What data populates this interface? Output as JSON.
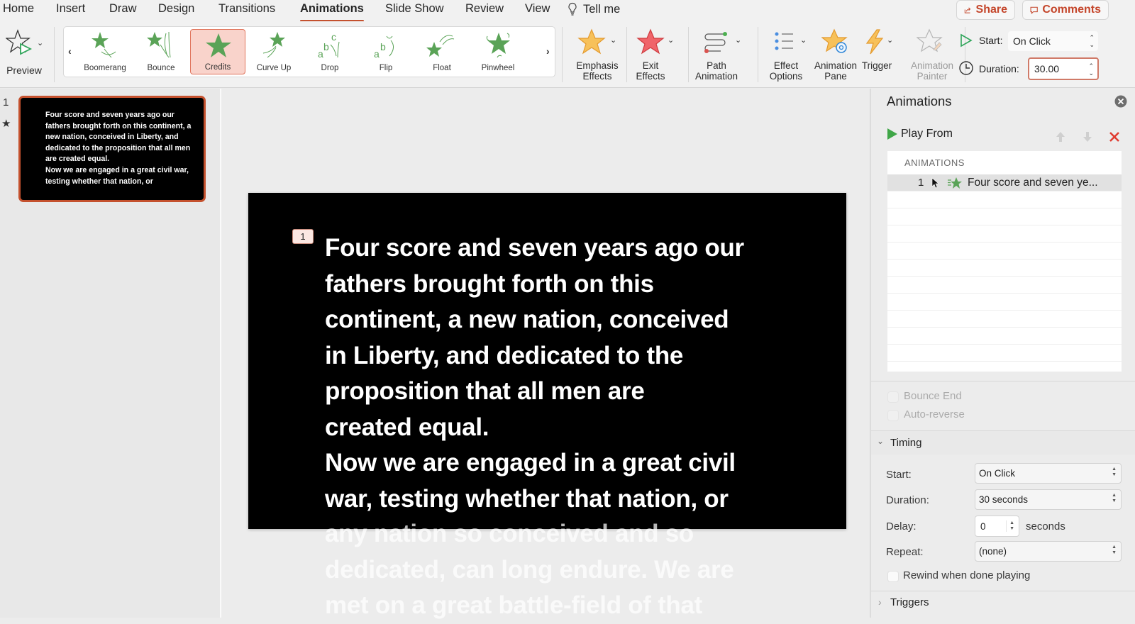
{
  "menu": {
    "tabs": [
      "Home",
      "Insert",
      "Draw",
      "Design",
      "Transitions",
      "Animations",
      "Slide Show",
      "Review",
      "View"
    ],
    "active_tab": "Animations",
    "tell_me": "Tell me",
    "share": "Share",
    "comments": "Comments"
  },
  "ribbon": {
    "preview": "Preview",
    "gallery": [
      {
        "label": "Boomerang",
        "icon": "boomerang-star-icon"
      },
      {
        "label": "Bounce",
        "icon": "bounce-star-icon"
      },
      {
        "label": "Credits",
        "icon": "credits-star-icon",
        "selected": true
      },
      {
        "label": "Curve Up",
        "icon": "curve-up-star-icon"
      },
      {
        "label": "Drop",
        "icon": "drop-abc-icon"
      },
      {
        "label": "Flip",
        "icon": "flip-abc-icon"
      },
      {
        "label": "Float",
        "icon": "float-star-icon"
      },
      {
        "label": "Pinwheel",
        "icon": "pinwheel-star-icon"
      }
    ],
    "emphasis_line1": "Emphasis",
    "emphasis_line2": "Effects",
    "exit_line1": "Exit",
    "exit_line2": "Effects",
    "path_line1": "Path",
    "path_line2": "Animation",
    "effect_line1": "Effect",
    "effect_line2": "Options",
    "pane_line1": "Animation",
    "pane_line2": "Pane",
    "trigger": "Trigger",
    "painter_line1": "Animation",
    "painter_line2": "Painter",
    "start_label": "Start:",
    "start_value": "On Click",
    "duration_label": "Duration:",
    "duration_value": "30.00"
  },
  "thumbnails": {
    "slide_number": "1",
    "text": "Four score and seven years ago our fathers brought forth on this continent, a new nation, conceived in Liberty, and dedicated to the proposition that all men are created equal.\nNow we are engaged in a great civil war, testing whether that nation, or"
  },
  "slide": {
    "animation_tag": "1",
    "text_lines": [
      "Four score and seven years ago our",
      "fathers brought forth on this",
      "continent, a new nation, conceived",
      "in Liberty, and dedicated to the",
      "proposition that all men are",
      "created equal.",
      "Now we are engaged in a great civil",
      "war, testing whether that nation, or"
    ],
    "overflow_lines": [
      "any nation so conceived and so",
      "dedicated, can long endure. We are",
      "met on a great battle-field of that"
    ]
  },
  "pane": {
    "title": "Animations",
    "play_from": "Play From",
    "list_header": "ANIMATIONS",
    "items": [
      {
        "index": "1",
        "label": "Four score and seven ye..."
      }
    ],
    "bounce_end": "Bounce End",
    "auto_reverse": "Auto-reverse",
    "timing_header": "Timing",
    "start_label": "Start:",
    "start_value": "On Click",
    "duration_label": "Duration:",
    "duration_value": "30 seconds",
    "delay_label": "Delay:",
    "delay_value": "0",
    "delay_unit": "seconds",
    "repeat_label": "Repeat:",
    "repeat_value": "(none)",
    "rewind_label": "Rewind when done playing",
    "triggers_header": "Triggers"
  },
  "colors": {
    "accent": "#c4512e",
    "anim_green": "#5aa357",
    "delete_red": "#e03c31"
  }
}
